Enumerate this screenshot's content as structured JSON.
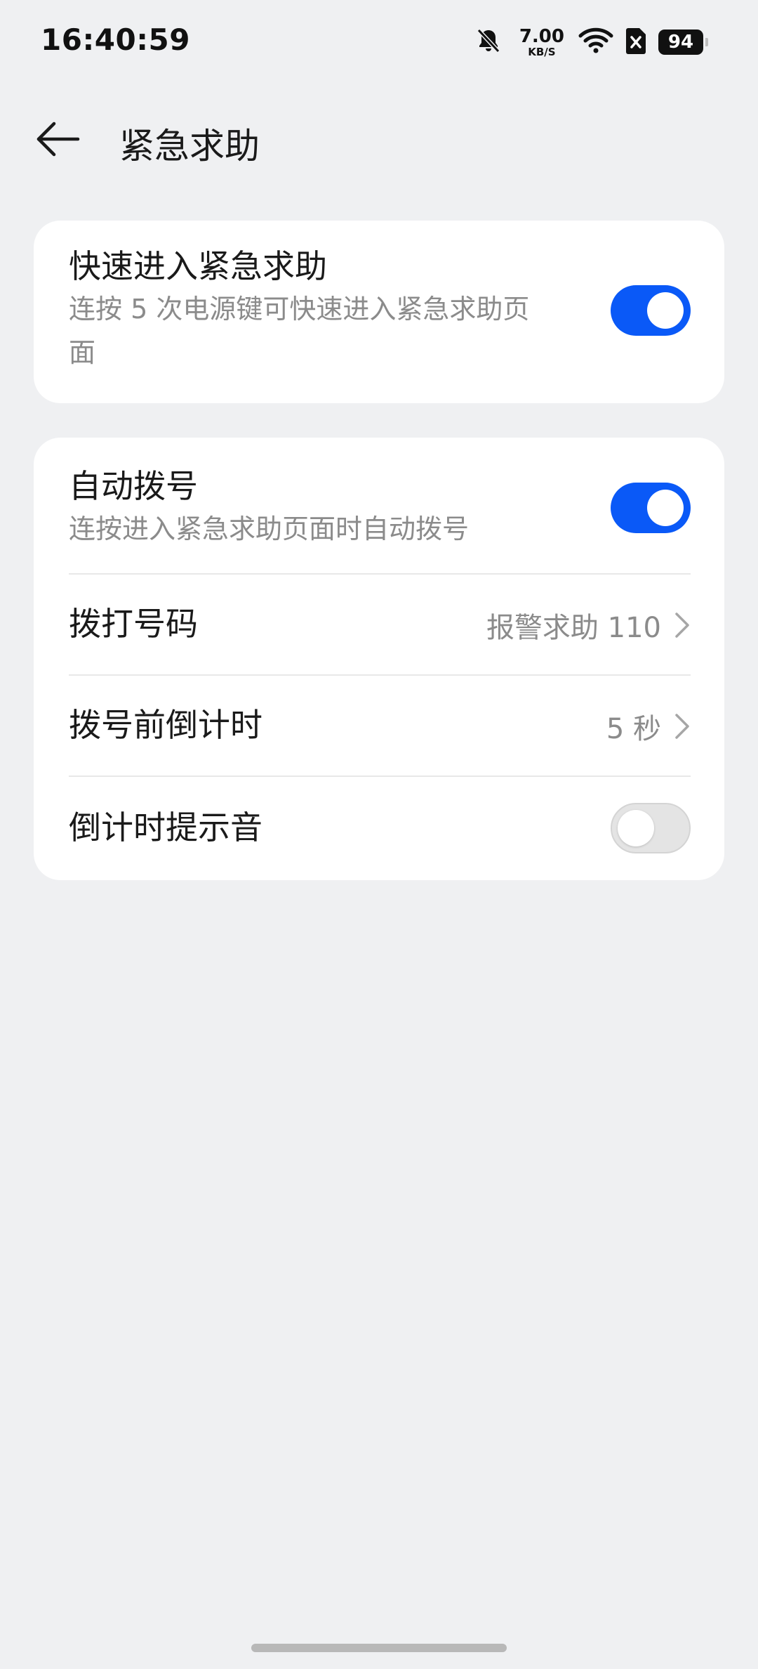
{
  "status_bar": {
    "time": "16:40:59",
    "net_speed_value": "7.00",
    "net_speed_unit": "KB/S",
    "battery_level": "94",
    "icons": [
      "bell-muted-icon",
      "wifi-icon",
      "sim-none-icon",
      "battery-icon"
    ]
  },
  "header": {
    "back_icon": "arrow-left-icon",
    "title": "紧急求助"
  },
  "quick_entry": {
    "title": "快速进入紧急求助",
    "subtitle_line1": "连按 5 次电源键可快速进入紧急求助页",
    "subtitle_line2": "面",
    "enabled": true
  },
  "auto_dial": {
    "title": "自动拨号",
    "subtitle": "连按进入紧急求助页面时自动拨号",
    "enabled": true
  },
  "dial_number": {
    "title": "拨打号码",
    "value": "报警求助 110",
    "icon": "chevron-right-icon"
  },
  "countdown": {
    "title": "拨号前倒计时",
    "value": "5 秒",
    "icon": "chevron-right-icon"
  },
  "countdown_sound": {
    "title": "倒计时提示音",
    "enabled": false
  },
  "colors": {
    "accent": "#0a59f7",
    "background": "#eff0f2",
    "card": "#ffffff",
    "secondary_text": "#8b8b8b"
  }
}
